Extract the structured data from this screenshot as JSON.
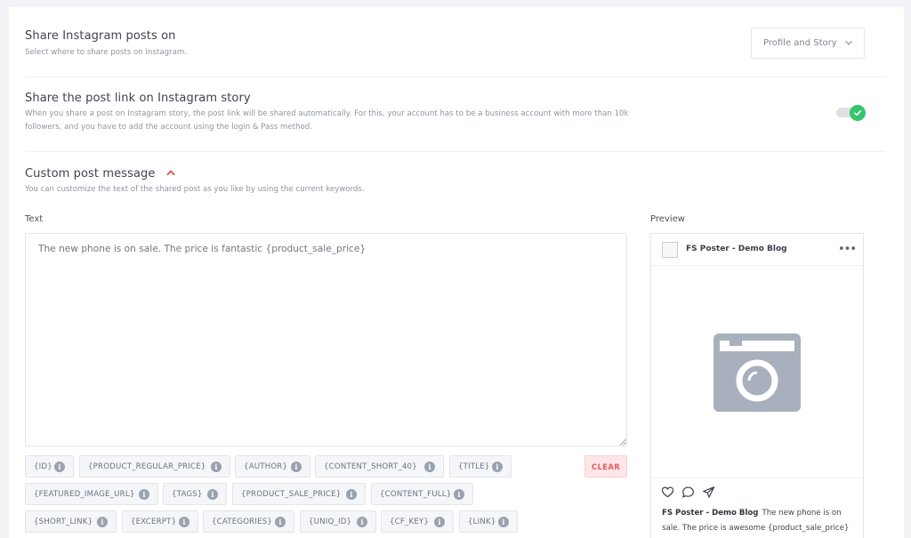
{
  "share_on": {
    "title": "Share Instagram posts on",
    "description": "Select where to share posts on Instagram.",
    "selected": "Profile and Story"
  },
  "story_link": {
    "title": "Share the post link on Instagram story",
    "description": "When you share a post on Instagram story, the post link will be shared automatically. For this, your account has to be a business account with more than 10k followers, and you have to add the account using the login & Pass method.",
    "enabled": true
  },
  "custom_message": {
    "title": "Custom post message",
    "description": "You can customize the text of the shared post as you like by using the current keywords.",
    "text_label": "Text",
    "text_value": "The new phone is on sale. The price is fantastic {product_sale_price}",
    "clear_label": "CLEAR",
    "keywords": [
      "{ID}",
      "{PRODUCT_REGULAR_PRICE}",
      "{AUTHOR}",
      "{CONTENT_SHORT_40}",
      "{TITLE}",
      "{FEATURED_IMAGE_URL}",
      "{TAGS}",
      "{PRODUCT_SALE_PRICE}",
      "{CONTENT_FULL}",
      "{SHORT_LINK}",
      "{EXCERPT}",
      "{CATEGORIES}",
      "{UNIQ_ID}",
      "{CF_KEY}",
      "{LINK}"
    ]
  },
  "preview": {
    "label": "Preview",
    "account_name": "FS Poster - Demo Blog",
    "more_icon": "•••",
    "caption_name": "FS Poster - Demo Blog",
    "caption_text": "The new phone is on sale. The price is awesome {product_sale_price}"
  },
  "colors": {
    "accent_green": "#37c56c",
    "clear_red": "#ea5a63",
    "caret_red": "#e5484d",
    "placeholder_gray": "#a7b0bc"
  }
}
